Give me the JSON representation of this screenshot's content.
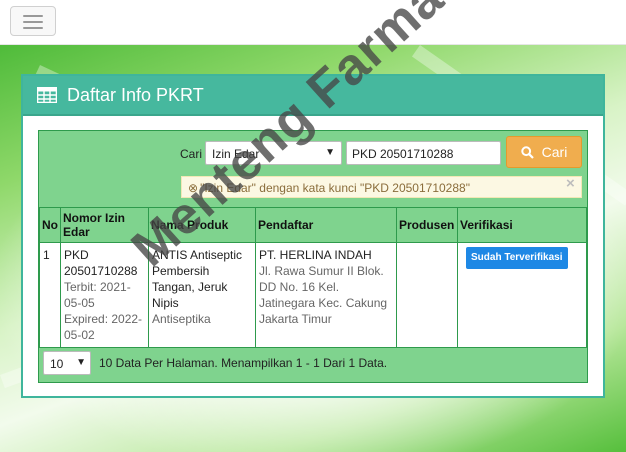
{
  "header": {
    "menu_icon": "hamburger-icon"
  },
  "panel": {
    "title": "Daftar Info PKRT",
    "title_icon": "table-icon"
  },
  "search": {
    "label": "Cari",
    "filter_selected": "Izin Edar",
    "query_value": "PKD 20501710288",
    "button_label": "Cari",
    "button_icon": "search-icon"
  },
  "alert": {
    "text": "\"Izin Edar\" dengan kata kunci \"PKD 20501710288\"",
    "close_glyph": "×"
  },
  "table": {
    "columns": [
      "No",
      "Nomor Izin Edar",
      "Nama Produk",
      "Pendaftar",
      "Produsen",
      "Verifikasi"
    ],
    "rows": [
      {
        "no": "1",
        "nomor": "PKD 20501710288",
        "terbit": "Terbit: 2021-05-05",
        "expired": "Expired: 2022-05-02",
        "nama": "ANTIS Antiseptic Pembersih Tangan, Jeruk Nipis",
        "kategori": "Antiseptika",
        "pendaftar": "PT. HERLINA INDAH",
        "alamat": "Jl. Rawa Sumur II Blok. DD No. 16 Kel. Jatinegara Kec. Cakung Jakarta Timur",
        "produsen": "",
        "verifikasi": "Sudah Terverifikasi"
      }
    ]
  },
  "pagination": {
    "per_page": "10",
    "summary": "10 Data Per Halaman. Menampilkan 1 - 1 Dari 1 Data."
  },
  "watermark": "Menteng Farma",
  "colors": {
    "panel_header": "#46b89e",
    "table_green": "#7fd38e",
    "search_button": "#f0ad4e",
    "badge": "#1e88e5"
  }
}
